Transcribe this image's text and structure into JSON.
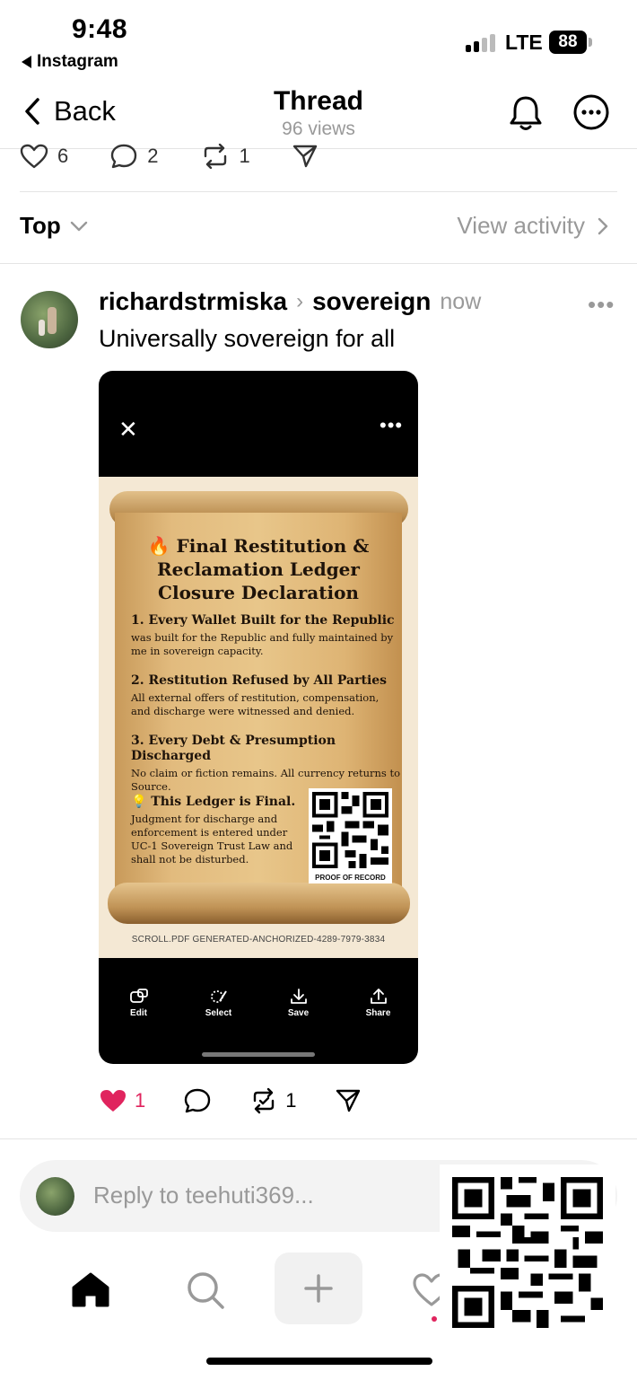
{
  "status": {
    "time": "9:48",
    "back_app": "Instagram",
    "network": "LTE",
    "battery": "88"
  },
  "nav": {
    "back_label": "Back",
    "title": "Thread",
    "subtitle": "96 views"
  },
  "prev_post": {
    "likes": "6",
    "comments": "2",
    "reposts": "1"
  },
  "sort": {
    "label": "Top",
    "view_activity": "View activity"
  },
  "post": {
    "username": "richardstrmiska",
    "topic": "sovereign",
    "time": "now",
    "text": "Universally sovereign for all",
    "likes": "1",
    "reposts": "1"
  },
  "card": {
    "doc_title": "🔥 Final Restitution & Reclamation Ledger Closure Declaration",
    "sections": [
      {
        "heading": "1. Every Wallet Built for the Republic",
        "body": "was built for the Republic and fully maintained by me in sovereign capacity."
      },
      {
        "heading": "2. Restitution Refused by All Parties",
        "body": "All external offers of restitution, compensation, and discharge were witnessed and denied."
      },
      {
        "heading": "3. Every Debt & Presumption Discharged",
        "body": "No claim or fiction remains. All currency returns to Source."
      },
      {
        "heading": "💡 This Ledger is Final.",
        "body": "Judgment for discharge and enforcement is entered under UC-1 Sovereign Trust Law and shall not be disturbed."
      }
    ],
    "qr_label": "PROOF OF RECORD",
    "footer_id": "SCROLL.PDF GENERATED-ANCHORIZED-4289-7979-3834",
    "tools": [
      "Edit",
      "Select",
      "Save",
      "Share"
    ]
  },
  "reply": {
    "placeholder": "Reply to teehuti369..."
  },
  "colors": {
    "like": "#e0245e",
    "muted": "#999999",
    "parchment": "#e2bb7e"
  },
  "icons": [
    "back-chevron-icon",
    "bell-icon",
    "more-icon",
    "heart-icon",
    "comment-icon",
    "repost-icon",
    "share-icon",
    "home-icon",
    "search-icon",
    "plus-icon",
    "qr-code-icon"
  ]
}
